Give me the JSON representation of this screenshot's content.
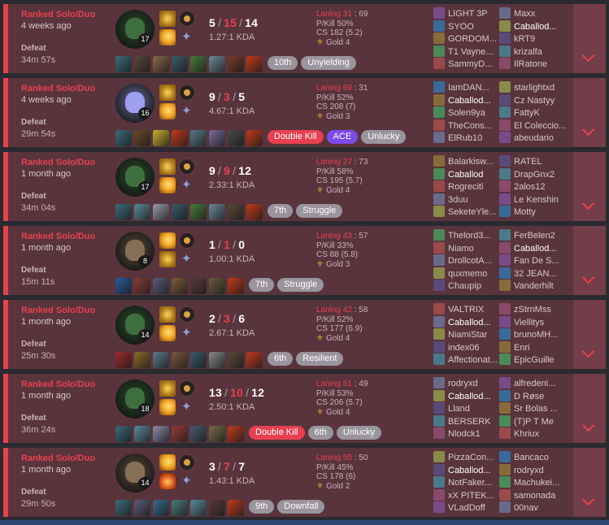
{
  "matches": [
    {
      "queue": "Ranked Solo/Duo",
      "ago": "4 weeks ago",
      "result": "Defeat",
      "duration": "34m 57s",
      "champion": {
        "name": "Warwick",
        "level": "17",
        "color": "#2a4a2a"
      },
      "spells": [
        "smite",
        "flash"
      ],
      "runes": [
        "conqueror",
        "resolve"
      ],
      "kda": {
        "k": "5",
        "d": "15",
        "a": "14",
        "ratio": "1.27:1 KDA"
      },
      "items": [
        "#3b6b7a",
        "#5b4a3a",
        "#8a6a4a",
        "#3a5a6a",
        "#4a7a3a",
        "#6a8a9a",
        "#7a3a2a",
        "#c23a1a"
      ],
      "tags": [
        {
          "label": "10th",
          "style": "grey"
        },
        {
          "label": "Unyielding",
          "style": "grey"
        }
      ],
      "laning": {
        "title": "Laning 31",
        "opp": "69",
        "pkill": "P/Kill 50%",
        "cs": "CS 182 (5.2)",
        "rank": "Gold 4"
      },
      "team1": [
        "LIGHT 3P",
        "SYOO",
        "GORDOM...",
        "T1 Vayne...",
        "SammyD..."
      ],
      "team2": [
        "Maxx",
        "Caballod...",
        "kRT9",
        "krizalfa",
        "IlRatone"
      ],
      "me": "team2.1"
    },
    {
      "queue": "Ranked Solo/Duo",
      "ago": "4 weeks ago",
      "result": "Defeat",
      "duration": "29m 54s",
      "champion": {
        "name": "Warwick",
        "level": "16",
        "color": "#6a6aa0"
      },
      "spells": [
        "smite",
        "flash"
      ],
      "runes": [
        "conqueror",
        "resolve"
      ],
      "kda": {
        "k": "9",
        "d": "3",
        "a": "5",
        "ratio": "4.67:1 KDA"
      },
      "items": [
        "#3b6b7a",
        "#6a4a2a",
        "#c8b02a",
        "#c23a1a",
        "#5a7a8a",
        "#7a6a9a",
        "#4a4a4a",
        "#c23a1a"
      ],
      "tags": [
        {
          "label": "Double Kill",
          "style": "red"
        },
        {
          "label": "ACE",
          "style": "purple"
        },
        {
          "label": "Unlucky",
          "style": "grey"
        }
      ],
      "laning": {
        "title": "Laning 69",
        "opp": "31",
        "pkill": "P/Kill 52%",
        "cs": "CS 208 (7)",
        "rank": "Gold 3"
      },
      "team1": [
        "IamDAN...",
        "Caballod...",
        "Solen9ya",
        "TheCons...",
        "ElRub10"
      ],
      "team2": [
        "starlightxd",
        "Cz Nastyy",
        "FattyK",
        "El Coleccio...",
        "abeudario"
      ],
      "me": "team1.1"
    },
    {
      "queue": "Ranked Solo/Duo",
      "ago": "1 month ago",
      "result": "Defeat",
      "duration": "34m 04s",
      "champion": {
        "name": "Warwick",
        "level": "17",
        "color": "#2a4a2a"
      },
      "spells": [
        "smite",
        "flash"
      ],
      "runes": [
        "conqueror",
        "resolve"
      ],
      "kda": {
        "k": "9",
        "d": "9",
        "a": "12",
        "ratio": "2.33:1 KDA"
      },
      "items": [
        "#3b6b7a",
        "#5a8a9a",
        "#9a9aaa",
        "#3a5a6a",
        "#4a7a3a",
        "#6a8a9a",
        "#5a4a3a",
        "#c23a1a"
      ],
      "tags": [
        {
          "label": "7th",
          "style": "grey"
        },
        {
          "label": "Struggle",
          "style": "grey"
        }
      ],
      "laning": {
        "title": "Laning 27",
        "opp": "73",
        "pkill": "P/Kill 58%",
        "cs": "CS 195 (5.7)",
        "rank": "Gold 4"
      },
      "team1": [
        "Balarkisw...",
        "Caballod",
        "Rogreciti",
        "3duu",
        "SeketeYle..."
      ],
      "team2": [
        "RATEL",
        "DrapGnx2",
        "2alos12",
        "Le Kenshin",
        "Motty"
      ],
      "me": "team1.1"
    },
    {
      "queue": "Ranked Solo/Duo",
      "ago": "1 month ago",
      "result": "Defeat",
      "duration": "15m 11s",
      "champion": {
        "name": "Jayce",
        "level": "8",
        "color": "#5a4a3a"
      },
      "spells": [
        "flash",
        "smite"
      ],
      "runes": [
        "conqueror",
        "resolve"
      ],
      "kda": {
        "k": "1",
        "d": "1",
        "a": "0",
        "ratio": "1.00:1 KDA"
      },
      "items": [
        "#2a5a9a",
        "#8a3a3a",
        "#5a5a7a",
        "#7a5a3a",
        "#5a3a3a",
        "#6a5a3a",
        "#c23a1a"
      ],
      "tags": [
        {
          "label": "7th",
          "style": "grey"
        },
        {
          "label": "Struggle",
          "style": "grey"
        }
      ],
      "laning": {
        "title": "Laning 43",
        "opp": "57",
        "pkill": "P/Kill 33%",
        "cs": "CS 88 (5.8)",
        "rank": "Gold 3"
      },
      "team1": [
        "Thelord3...",
        "Niamo",
        "DrollcotA...",
        "quxmemo",
        "Chaupip"
      ],
      "team2": [
        "FerBelen2",
        "Caballod...",
        "Fan De S...",
        "32 JEAN...",
        "Vanderhilt"
      ],
      "me": "team2.1"
    },
    {
      "queue": "Ranked Solo/Duo",
      "ago": "1 month ago",
      "result": "Defeat",
      "duration": "25m 30s",
      "champion": {
        "name": "Warwick",
        "level": "14",
        "color": "#2a4a2a"
      },
      "spells": [
        "smite",
        "flash"
      ],
      "runes": [
        "conqueror",
        "resolve"
      ],
      "kda": {
        "k": "2",
        "d": "3",
        "a": "6",
        "ratio": "2.67:1 KDA"
      },
      "items": [
        "#a02a2a",
        "#8a6a2a",
        "#5a7a8a",
        "#7a5a3a",
        "#3a5a6a",
        "#8a8a8a",
        "#5a4a3a",
        "#c23a1a"
      ],
      "tags": [
        {
          "label": "6th",
          "style": "grey"
        },
        {
          "label": "Resilient",
          "style": "grey"
        }
      ],
      "laning": {
        "title": "Laning 42",
        "opp": "58",
        "pkill": "P/Kill 52%",
        "cs": "CS 177 (6.9)",
        "rank": "Gold 4"
      },
      "team1": [
        "VALTRIX",
        "Caballod...",
        "NiamiStar",
        "index06",
        "Affectionat..."
      ],
      "team2": [
        "zStrnMss",
        "Viellitys",
        "brunoMH...",
        "Enri",
        "EpicGuille"
      ],
      "me": "team1.1"
    },
    {
      "queue": "Ranked Solo/Duo",
      "ago": "1 month ago",
      "result": "Defeat",
      "duration": "36m 24s",
      "champion": {
        "name": "Warwick",
        "level": "18",
        "color": "#2a4a2a"
      },
      "spells": [
        "smite",
        "flash"
      ],
      "runes": [
        "conqueror",
        "resolve"
      ],
      "kda": {
        "k": "13",
        "d": "10",
        "a": "12",
        "ratio": "2.50:1 KDA"
      },
      "items": [
        "#3b6b7a",
        "#5a8a9a",
        "#8a8aaa",
        "#9a3a3a",
        "#4a5a6a",
        "#7a6a4a",
        "#c23a1a"
      ],
      "tags": [
        {
          "label": "Double Kill",
          "style": "red"
        },
        {
          "label": "6th",
          "style": "grey"
        },
        {
          "label": "Unlucky",
          "style": "grey"
        }
      ],
      "laning": {
        "title": "Laning 51",
        "opp": "49",
        "pkill": "P/Kill 53%",
        "cs": "CS 206 (5.7)",
        "rank": "Gold 4"
      },
      "team1": [
        "rodryxd",
        "Caballod...",
        "Lland",
        "BERSERK",
        "Nlodck1"
      ],
      "team2": [
        "alfredeni...",
        "D Røse",
        "Sr Bolas ...",
        "(T)P T Me",
        "Khriux"
      ],
      "me": "team1.1"
    },
    {
      "queue": "Ranked Solo/Duo",
      "ago": "1 month ago",
      "result": "Defeat",
      "duration": "29m 50s",
      "champion": {
        "name": "Jayce",
        "level": "14",
        "color": "#5a4a3a"
      },
      "spells": [
        "flash",
        "ignite"
      ],
      "runes": [
        "conqueror",
        "resolve"
      ],
      "kda": {
        "k": "3",
        "d": "7",
        "a": "7",
        "ratio": "1.43:1 KDA"
      },
      "items": [
        "#3b6b7a",
        "#5a5a7a",
        "#3a6a8a",
        "#4a7a7a",
        "#5a8a9a",
        "#5a3a3a",
        "#c23a1a"
      ],
      "tags": [
        {
          "label": "9th",
          "style": "grey"
        },
        {
          "label": "Downfall",
          "style": "grey"
        }
      ],
      "laning": {
        "title": "Laning 50",
        "opp": "50",
        "pkill": "P/Kill 45%",
        "cs": "CS 178 (6)",
        "rank": "Gold 2"
      },
      "team1": [
        "PizzaCon...",
        "Caballod...",
        "NotFaker...",
        "xX PITEK...",
        "VLadDoff"
      ],
      "team2": [
        "Bancaco",
        "rodryxd",
        "Machukei...",
        "samonada",
        "00nav"
      ],
      "me": "team1.1"
    }
  ]
}
